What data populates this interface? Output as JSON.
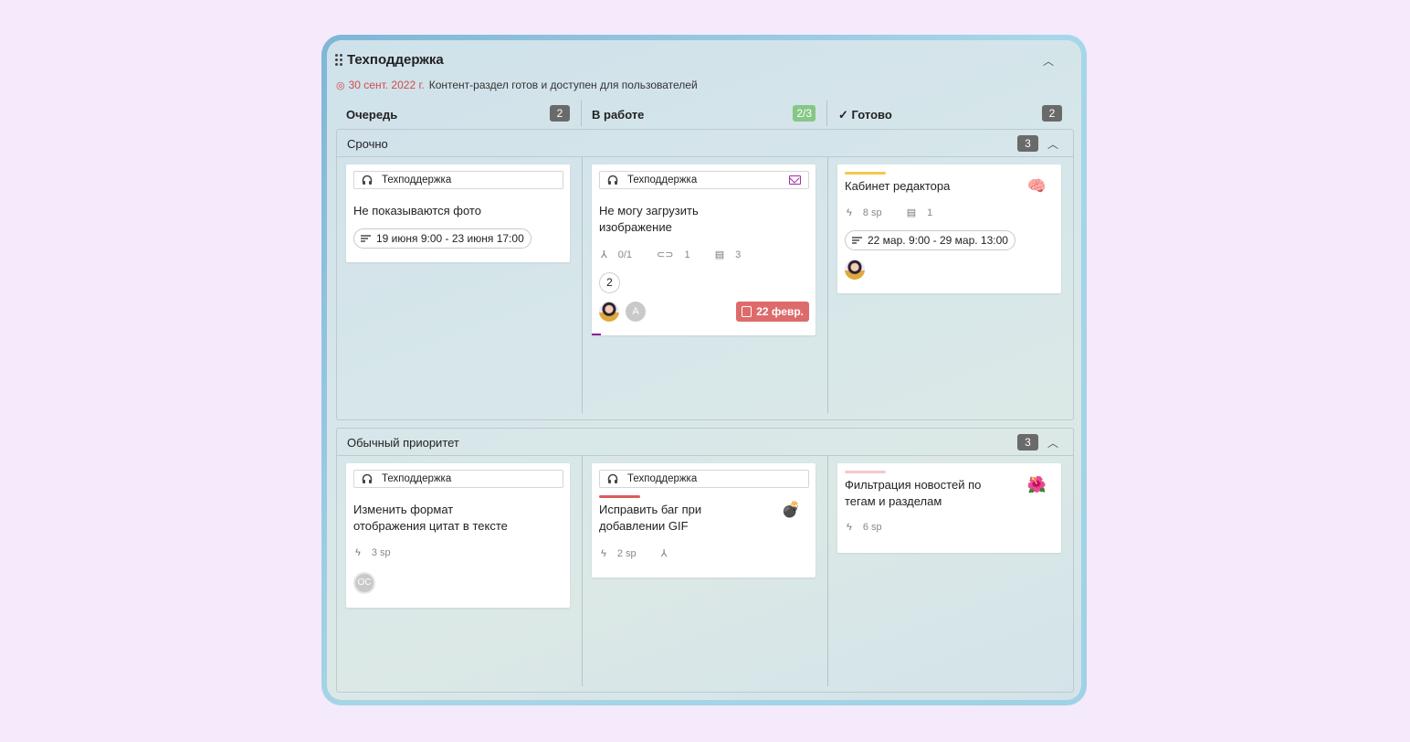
{
  "board": {
    "title": "Техподдержка",
    "goal_date": "30 сент. 2022 г.",
    "goal_text": "Контент-раздел готов и доступен для пользователей"
  },
  "columns": [
    {
      "label": "Очередь",
      "count": "2"
    },
    {
      "label": "В работе",
      "count": "2/3"
    },
    {
      "label": "Готово",
      "count": "2",
      "check": "✓"
    }
  ],
  "lanes": [
    {
      "name": "Срочно",
      "count": "3"
    },
    {
      "name": "Обычный приоритет",
      "count": "3"
    }
  ],
  "cards": {
    "c1": {
      "tag": "Техподдержка",
      "title": "Не показываются фото",
      "dates": "19 июня 9:00 - 23 июня 17:00"
    },
    "c2": {
      "tag": "Техподдержка",
      "title_line1": "Не могу загрузить",
      "title_line2": "изображение",
      "subtasks": "0/1",
      "attachments": "1",
      "comments": "3",
      "number": "2",
      "avatar2": "A",
      "due": "22 февр."
    },
    "c3": {
      "title": "Кабинет редактора",
      "sp": "8 sp",
      "comments": "1",
      "dates": "22 мар. 9:00 - 29 мар. 13:00",
      "emoji": "🧠",
      "stripe_color": "#f2c94c"
    },
    "c4": {
      "tag": "Техподдержка",
      "title_line1": "Изменить формат",
      "title_line2": "отображения цитат в тексте",
      "sp": "3 sp",
      "avatar": "OC"
    },
    "c5": {
      "tag": "Техподдержка",
      "title_line1": "Исправить баг при",
      "title_line2": "добавлении GIF",
      "sp": "2 sp",
      "emoji": "💣",
      "stripe_color": "#dd5b5b"
    },
    "c6": {
      "title_line1": "Фильтрация новостей по",
      "title_line2": "тегам и разделам",
      "sp": "6 sp",
      "emoji": "🌺",
      "stripe_color": "#f5c7cf"
    }
  }
}
